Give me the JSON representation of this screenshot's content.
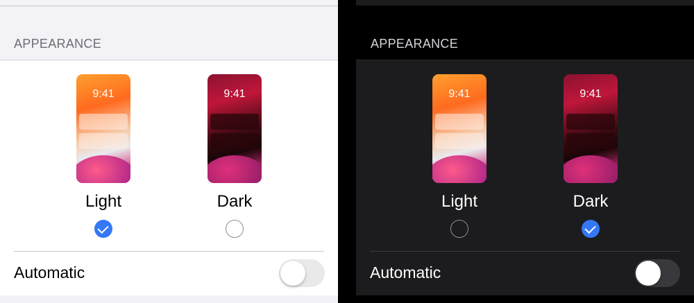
{
  "light_panel": {
    "section_header": "APPEARANCE",
    "options": [
      {
        "time": "9:41",
        "label": "Light",
        "selected": true
      },
      {
        "time": "9:41",
        "label": "Dark",
        "selected": false
      }
    ],
    "automatic": {
      "label": "Automatic",
      "enabled": false
    }
  },
  "dark_panel": {
    "section_header": "APPEARANCE",
    "options": [
      {
        "time": "9:41",
        "label": "Light",
        "selected": false
      },
      {
        "time": "9:41",
        "label": "Dark",
        "selected": true
      }
    ],
    "automatic": {
      "label": "Automatic",
      "enabled": false
    }
  },
  "colors": {
    "accent": "#3478f6",
    "light_background": "#f2f2f7",
    "dark_background": "#000000"
  }
}
